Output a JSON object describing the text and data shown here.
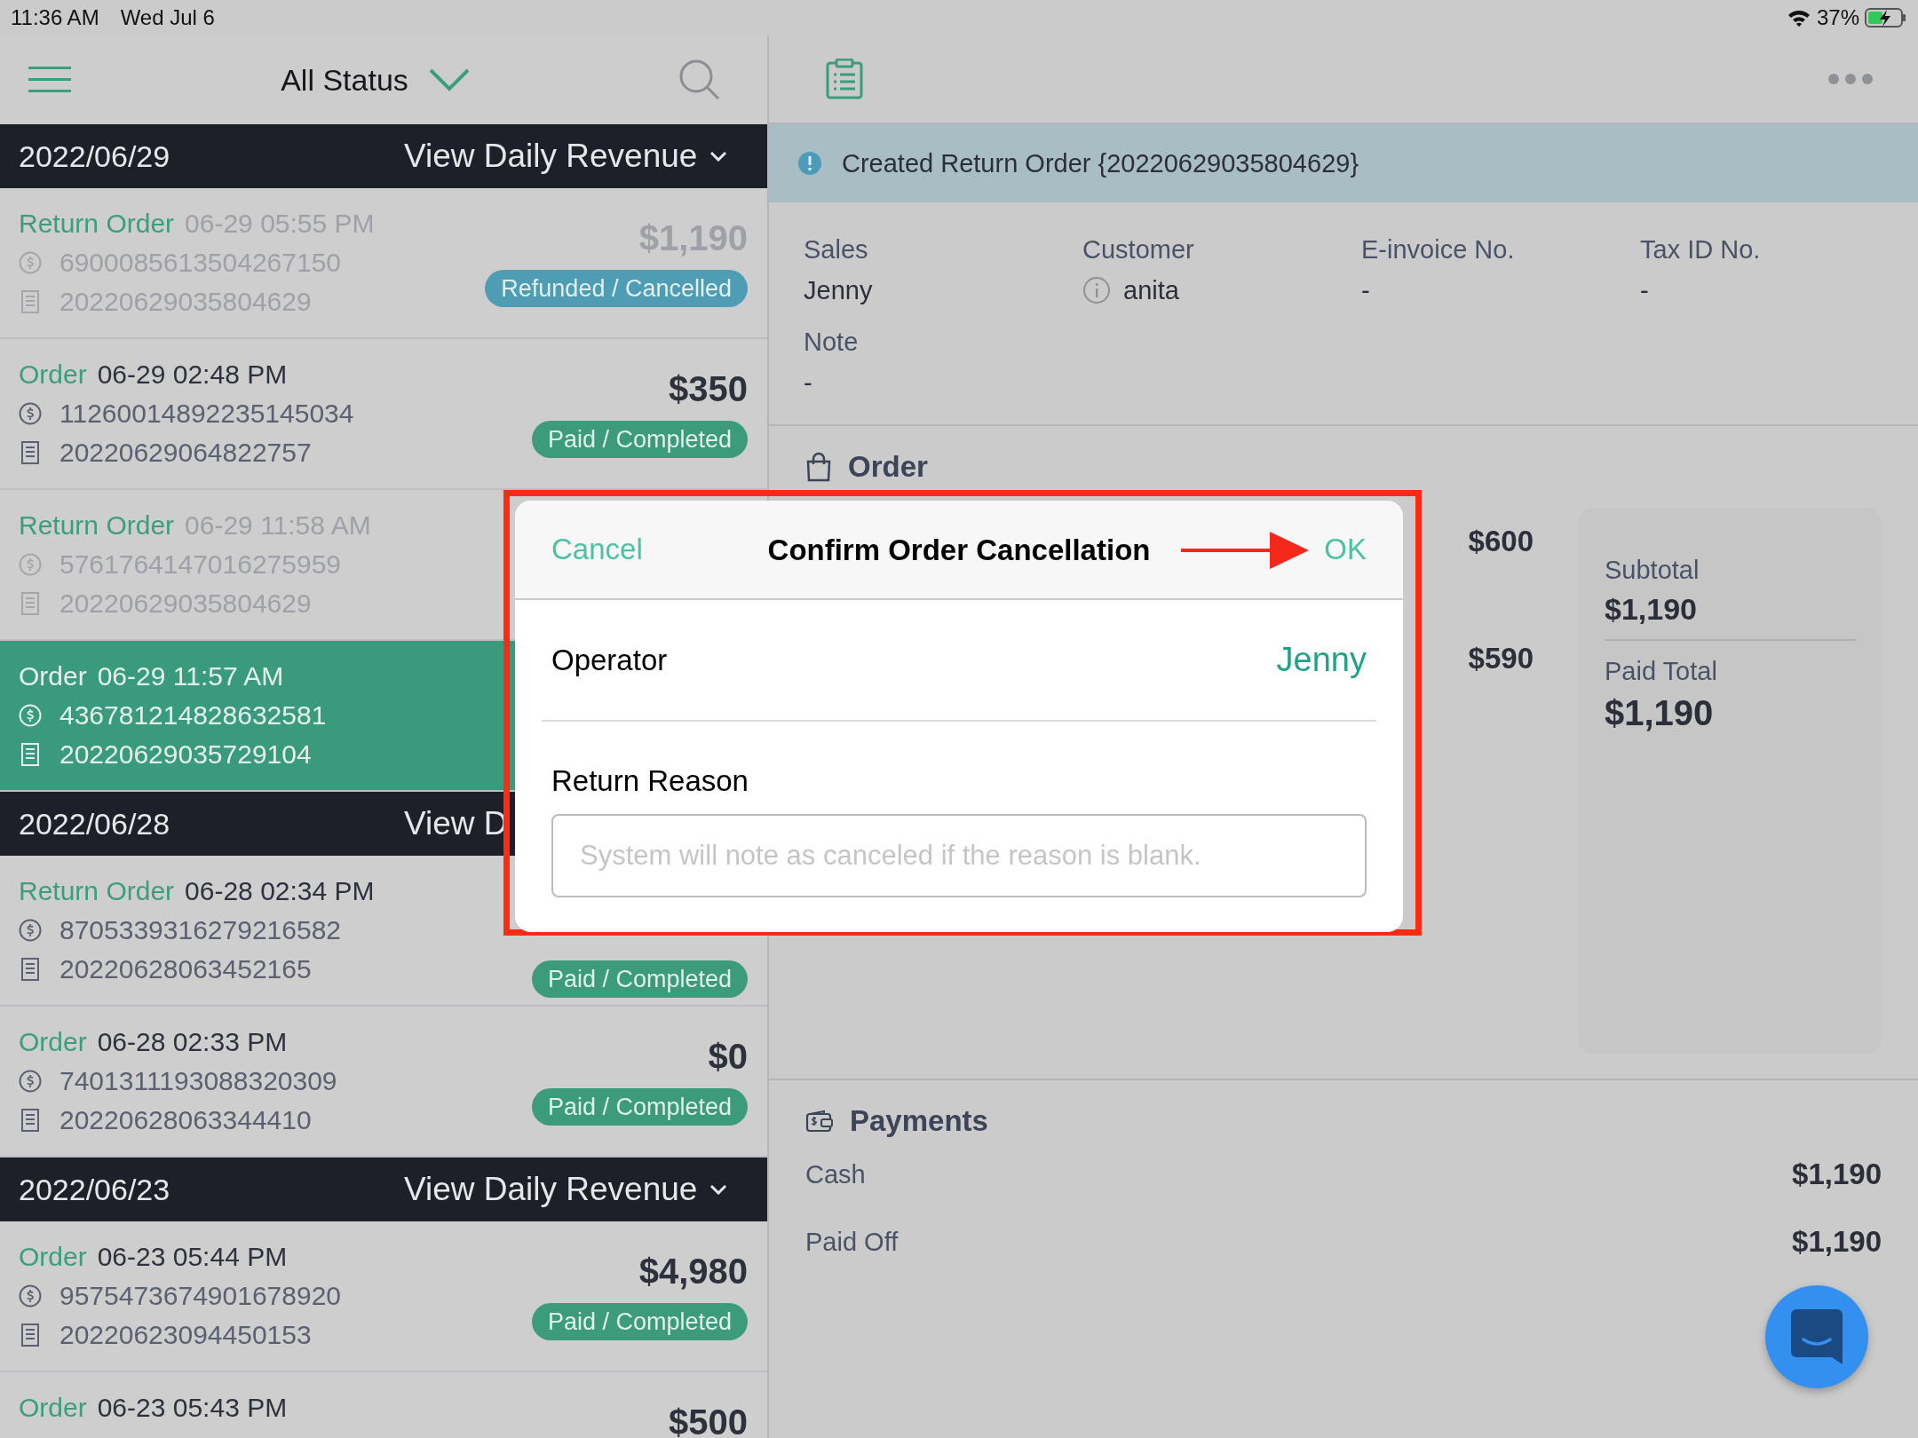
{
  "status_bar": {
    "time": "11:36 AM",
    "date": "Wed Jul 6",
    "battery": "37%"
  },
  "list_toolbar": {
    "filter": "All Status"
  },
  "groups": [
    {
      "date": "2022/06/29",
      "revenue_link": "View Daily Revenue",
      "chevron": true,
      "orders": [
        {
          "type": "Return Order",
          "time": "06-29 05:55 PM",
          "muted": true,
          "selected": false,
          "transaction_no": "6900085613504267150",
          "order_no": "20220629035804629",
          "amount": "$1,190",
          "status": {
            "label": "Refunded / Cancelled",
            "color": "#4f9db5"
          }
        },
        {
          "type": "Order",
          "time": "06-29 02:48 PM",
          "muted": false,
          "selected": false,
          "transaction_no": "11260014892235145034",
          "order_no": "20220629064822757",
          "amount": "$350",
          "status": {
            "label": "Paid / Completed",
            "color": "#3b9b7a"
          }
        },
        {
          "type": "Return Order",
          "time": "06-29 11:58 AM",
          "muted": true,
          "selected": false,
          "transaction_no": "5761764147016275959",
          "order_no": "20220629035804629"
        },
        {
          "type": "Order",
          "time": "06-29 11:57 AM",
          "muted": false,
          "selected": true,
          "transaction_no": "436781214828632581",
          "order_no": "20220629035729104"
        }
      ]
    },
    {
      "date": "2022/06/28",
      "revenue_link": "View D",
      "orders": [
        {
          "type": "Return Order",
          "time": "06-28 02:34 PM",
          "muted": false,
          "selected": false,
          "transaction_no": "8705339316279216582",
          "order_no": "20220628063452165",
          "status": {
            "label": "Paid / Completed",
            "color": "#3b9b7a"
          }
        },
        {
          "type": "Order",
          "time": "06-28 02:33 PM",
          "muted": false,
          "selected": false,
          "transaction_no": "7401311193088320309",
          "order_no": "20220628063344410",
          "amount": "$0",
          "status": {
            "label": "Paid / Completed",
            "color": "#3b9b7a"
          }
        }
      ]
    },
    {
      "date": "2022/06/23",
      "revenue_link": "View Daily Revenue",
      "chevron": true,
      "orders": [
        {
          "type": "Order",
          "time": "06-23 05:44 PM",
          "muted": false,
          "selected": false,
          "transaction_no": "9575473674901678920",
          "order_no": "20220623094450153",
          "amount": "$4,980",
          "status": {
            "label": "Paid / Completed",
            "color": "#3b9b7a"
          }
        },
        {
          "type": "Order",
          "time": "06-23 05:43 PM",
          "muted": false,
          "selected": false,
          "amount": "$500"
        }
      ]
    }
  ],
  "detail": {
    "banner": "Created Return Order {20220629035804629}",
    "fields": [
      {
        "label": "Sales",
        "value": "Jenny",
        "kind": "text"
      },
      {
        "label": "Customer",
        "value": "anita",
        "kind": "customer"
      },
      {
        "label": "E-invoice No.",
        "value": "-",
        "kind": "text"
      },
      {
        "label": "Tax ID No.",
        "value": "-",
        "kind": "text"
      }
    ],
    "note": {
      "label": "Note",
      "value": "-"
    },
    "order": {
      "title": "Order",
      "item_amounts": [
        "$600",
        "$590"
      ],
      "summary": [
        {
          "label": "Subtotal",
          "value": "$1,190",
          "kind": "line"
        },
        {
          "label": "Paid Total",
          "value": "$1,190",
          "kind": "total"
        }
      ]
    },
    "payments": {
      "title": "Payments",
      "rows": [
        {
          "label": "Cash",
          "value": "$1,190"
        },
        {
          "label": "Paid Off",
          "value": "$1,190"
        }
      ]
    }
  },
  "dialog": {
    "cancel": "Cancel",
    "title": "Confirm Order Cancellation",
    "ok": "OK",
    "operator_label": "Operator",
    "operator": "Jenny",
    "reason_label": "Return Reason",
    "reason_placeholder": "System will note as canceled if the reason is blank."
  }
}
